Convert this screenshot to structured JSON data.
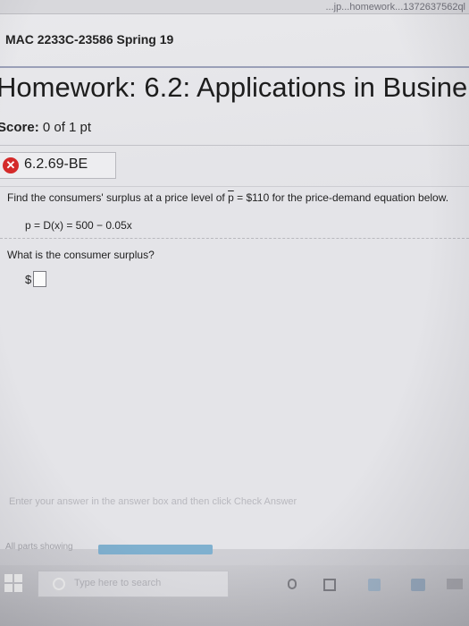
{
  "browser": {
    "url_fragment": "...jp...homework...1372637562ql"
  },
  "course": {
    "title": "MAC 2233C-23586 Spring 19"
  },
  "assignment": {
    "title": "Homework: 6.2: Applications in Busine"
  },
  "score": {
    "label": "Score:",
    "value": "0 of 1 pt"
  },
  "question": {
    "id": "6.2.69-BE",
    "status_icon": "x-circle-icon",
    "status_color": "#d42a2a",
    "prompt_before": "Find the consumers' surplus at a price level of ",
    "prompt_pbar": "p",
    "prompt_after": " = $110 for the price-demand equation below.",
    "equation": "p = D(x) = 500 − 0.05x",
    "ask": "What is the consumer surplus?",
    "currency": "$",
    "answer_value": ""
  },
  "footer": {
    "hint": "Enter your answer in the answer box and then click Check Answer",
    "parts_label": "All parts showing",
    "progress_fraction": 1.0
  },
  "taskbar": {
    "search_placeholder": "Type here to search",
    "accent": "#7fb0cf"
  }
}
